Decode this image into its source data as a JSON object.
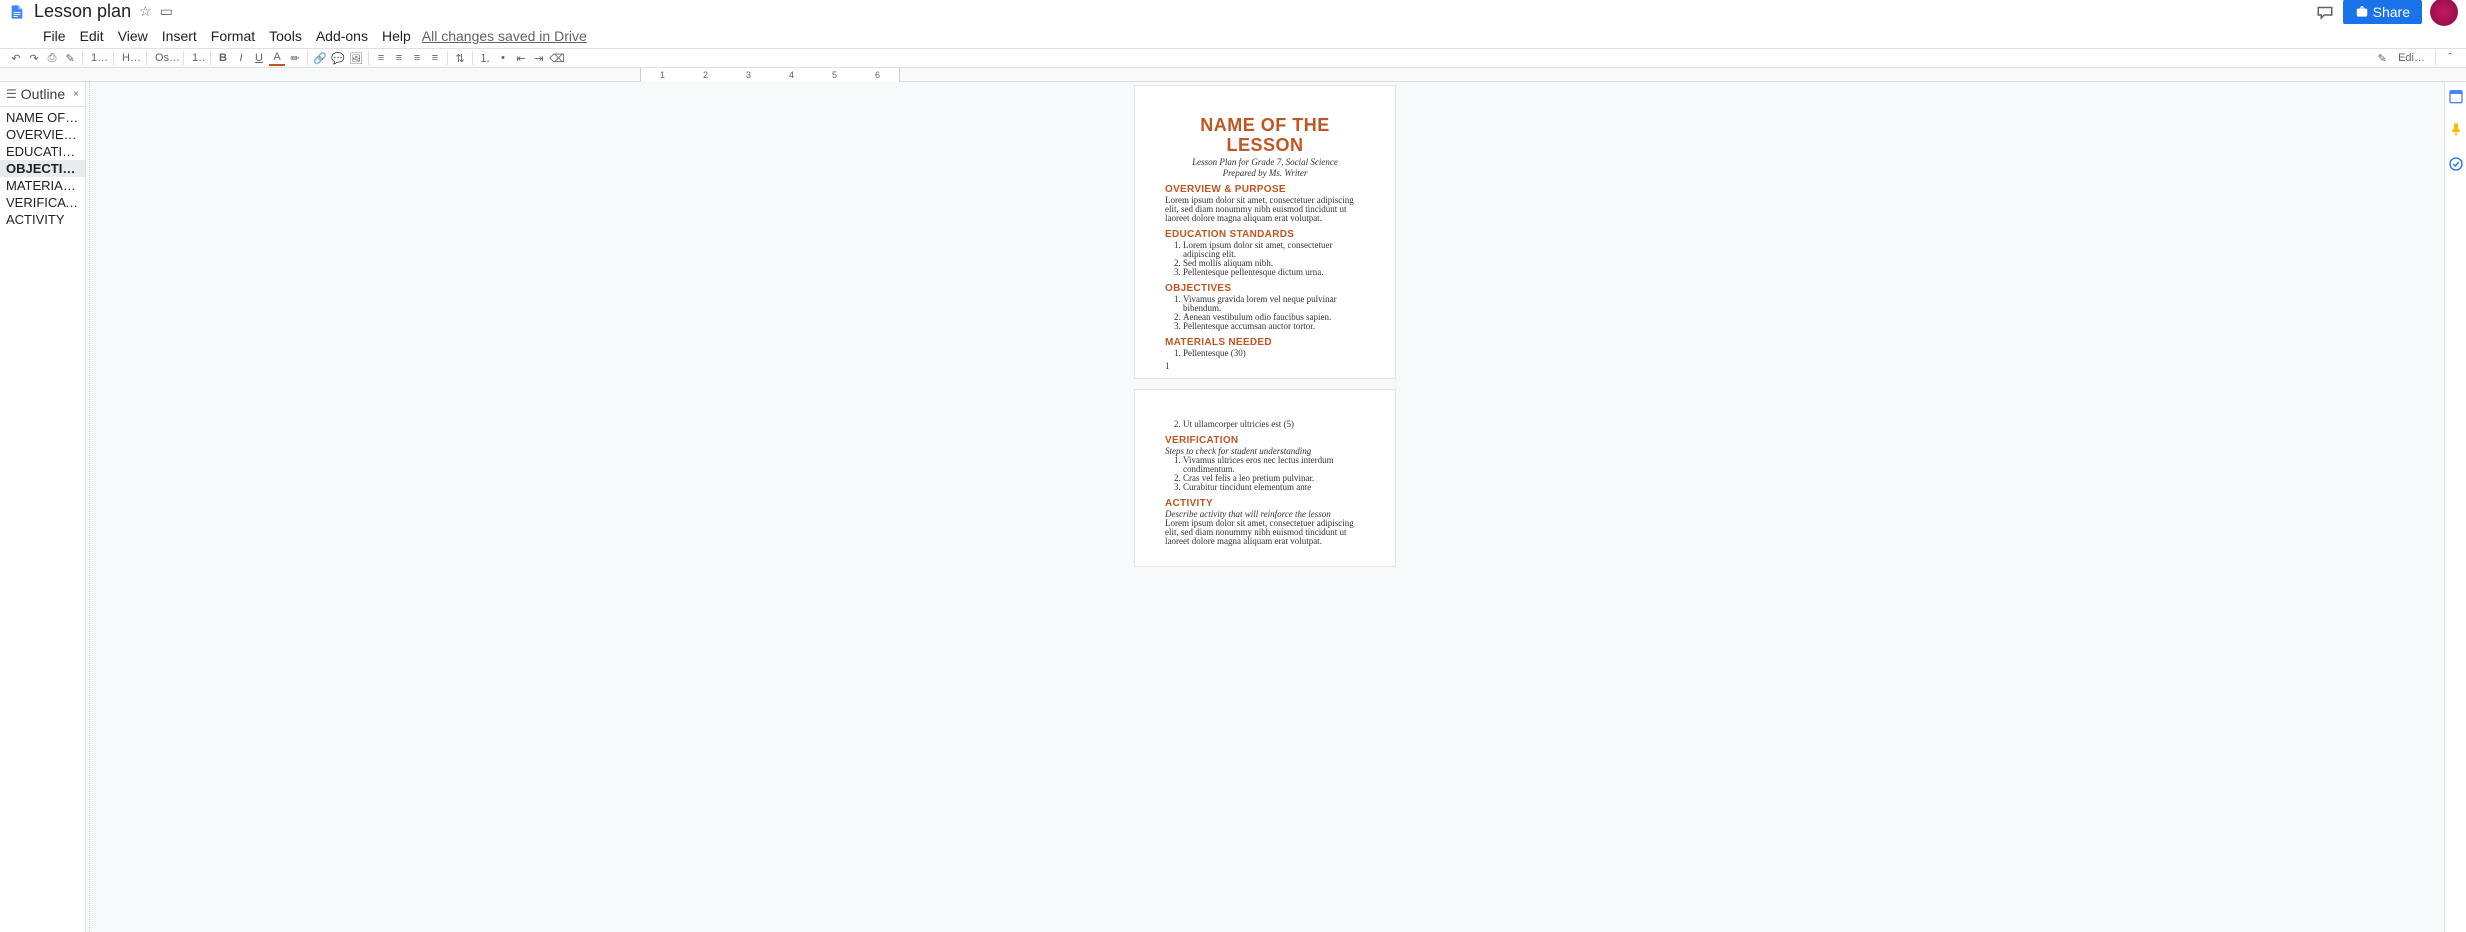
{
  "app": {
    "doc_title": "Lesson plan",
    "save_status": "All changes saved in Drive",
    "share_label": "Share",
    "editing_label": "Edi…"
  },
  "menu": [
    "File",
    "Edit",
    "View",
    "Insert",
    "Format",
    "Tools",
    "Add-ons",
    "Help"
  ],
  "toolbar": {
    "style": "H…",
    "font": "Os…",
    "font_size": "1…"
  },
  "ruler": [
    "1",
    "2",
    "3",
    "4",
    "5",
    "6"
  ],
  "outline": {
    "header": "Outline",
    "items": [
      {
        "label": "NAME OF T…",
        "selected": false
      },
      {
        "label": "OVERVIEW …",
        "selected": false
      },
      {
        "label": "EDUCATION…",
        "selected": false
      },
      {
        "label": "OBJECTIVES",
        "selected": true
      },
      {
        "label": "MATERIALS…",
        "selected": false
      },
      {
        "label": "VERIFICATI…",
        "selected": false
      },
      {
        "label": "ACTIVITY",
        "selected": false
      }
    ]
  },
  "doc": {
    "title": "NAME OF THE LESSON",
    "subtitle1": "Lesson Plan for Grade 7, Social Science",
    "subtitle2": "Prepared by Ms. Writer",
    "sections": {
      "overview": {
        "heading": "OVERVIEW & PURPOSE",
        "body": "Lorem ipsum dolor sit amet, consectetuer adipiscing elit, sed diam nonummy nibh euismod tincidunt ut laoreet dolore magna aliquam erat volutpat."
      },
      "standards": {
        "heading": "EDUCATION STANDARDS",
        "items": [
          "Lorem ipsum dolor sit amet, consectetuer adipiscing elit.",
          "Sed mollis aliquam nibh.",
          "Pellentesque pellentesque dictum urna."
        ]
      },
      "objectives": {
        "heading": "OBJECTIVES",
        "items": [
          "Vivamus gravida lorem vel neque pulvinar bibendum.",
          "Aenean vestibulum odio faucibus sapien.",
          "Pellentesque accumsan auctor tortor."
        ]
      },
      "materials": {
        "heading": "MATERIALS NEEDED",
        "items_p1": [
          "Pellentesque (30)"
        ],
        "items_p2": [
          "Ut ullamcorper ultricies est (5)"
        ]
      },
      "verification": {
        "heading": "VERIFICATION",
        "note": "Steps to check for student understanding",
        "items": [
          "Vivamus ultrices eros nec lectus interdum condimentum.",
          "Cras vel felis a leo pretium pulvinar.",
          "Curabitur tincidunt elementum ante"
        ]
      },
      "activity": {
        "heading": "ACTIVITY",
        "note": "Describe activity that will reinforce the lesson",
        "body": "Lorem ipsum dolor sit amet, consectetuer adipiscing elit, sed diam nonummy nibh euismod tincidunt ut laoreet dolore magna aliquam erat volutpat."
      }
    },
    "page_number": "1"
  }
}
